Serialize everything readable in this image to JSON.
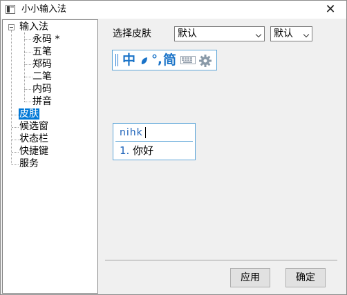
{
  "window": {
    "title": "小小输入法",
    "close_symbol": "✕"
  },
  "tree": {
    "root": "输入法",
    "children": [
      "永码 *",
      "五笔",
      "郑码",
      "二笔",
      "内码",
      "拼音"
    ],
    "items": [
      "皮肤",
      "候选窗",
      "状态栏",
      "快捷键",
      "服务"
    ],
    "selected": "皮肤"
  },
  "skin": {
    "label": "选择皮肤",
    "skin_select": "默认",
    "variant_select": "默认"
  },
  "toolbar_preview": {
    "chinese_mode": "中",
    "punct_mode": "°,",
    "simplified": "简",
    "icons": [
      "half-moon-icon",
      "keyboard-icon",
      "gear-icon"
    ]
  },
  "candidate_preview": {
    "input": "nihk",
    "number": "1.",
    "candidate": "你好"
  },
  "buttons": {
    "apply": "应用",
    "ok": "确定"
  },
  "colors": {
    "accent": "#1a73c8",
    "selection": "#0078d7",
    "preview_border": "#5ea6d8"
  }
}
